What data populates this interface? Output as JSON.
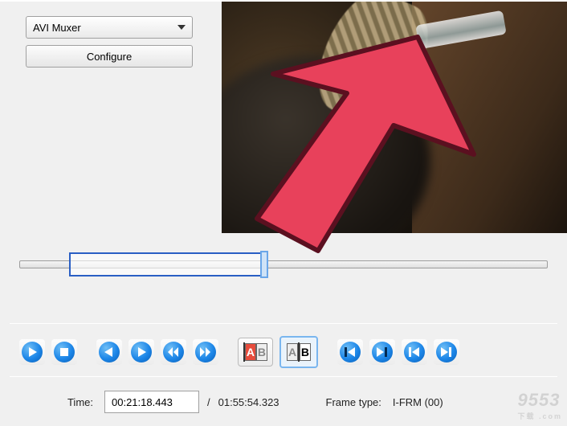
{
  "panel": {
    "format_dropdown": "AVI Muxer",
    "configure_label": "Configure"
  },
  "transport": {
    "play": "play",
    "stop": "stop",
    "prev": "prev",
    "next": "next",
    "rewind": "rewind",
    "fast_forward": "fast-forward",
    "mark_a": "A",
    "mark_b": "B",
    "prev_keyframe": "prev-keyframe",
    "next_keyframe": "next-keyframe",
    "prev_black": "prev-black",
    "next_black": "next-black"
  },
  "status": {
    "time_label": "Time:",
    "time_value": "00:21:18.443",
    "total_prefix": "/",
    "total_value": "01:55:54.323",
    "frame_label": "Frame type:",
    "frame_value": "I-FRM (00)"
  },
  "watermark": {
    "main": "9553",
    "sub": "下载 .com"
  }
}
